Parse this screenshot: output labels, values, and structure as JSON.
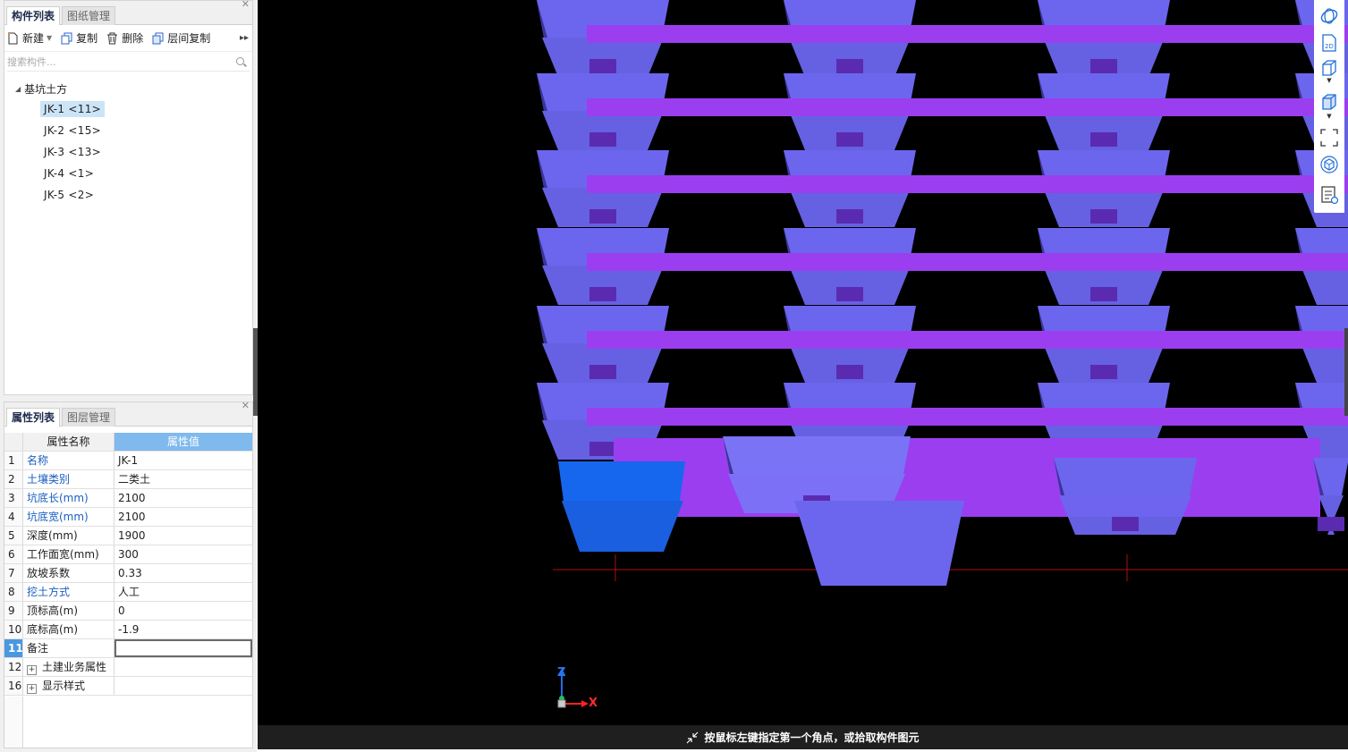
{
  "components_panel": {
    "tabs": [
      "构件列表",
      "图纸管理"
    ],
    "toolbar": {
      "new_label": "新建",
      "copy_label": "复制",
      "delete_label": "删除",
      "floor_copy_label": "层间复制",
      "more_icon": "double-chevron-right-icon"
    },
    "search_placeholder": "搜索构件...",
    "tree": {
      "root_label": "基坑土方",
      "items": [
        "JK-1 <11>",
        "JK-2 <15>",
        "JK-3 <13>",
        "JK-4 <1>",
        "JK-5 <2>"
      ],
      "selected": "JK-1 <11>"
    }
  },
  "properties_panel": {
    "tabs": [
      "属性列表",
      "图层管理"
    ],
    "header": {
      "name_col": "属性名称",
      "value_col": "属性值"
    },
    "rows": [
      {
        "num": "1",
        "name": "名称",
        "value": "JK-1"
      },
      {
        "num": "2",
        "name": "土壤类别",
        "value": "二类土"
      },
      {
        "num": "3",
        "name": "坑底长(mm)",
        "value": "2100"
      },
      {
        "num": "4",
        "name": "坑底宽(mm)",
        "value": "2100"
      },
      {
        "num": "5",
        "name": "深度(mm)",
        "value": "1900"
      },
      {
        "num": "6",
        "name": "工作面宽(mm)",
        "value": "300"
      },
      {
        "num": "7",
        "name": "放坡系数",
        "value": "0.33"
      },
      {
        "num": "8",
        "name": "挖土方式",
        "value": "人工"
      },
      {
        "num": "9",
        "name": "顶标高(m)",
        "value": "0"
      },
      {
        "num": "10",
        "name": "底标高(m)",
        "value": "-1.9"
      },
      {
        "num": "11",
        "name": "备注",
        "value": ""
      },
      {
        "num": "12",
        "name": "土建业务属性",
        "value": ""
      },
      {
        "num": "16",
        "name": "显示样式",
        "value": ""
      }
    ]
  },
  "viewport": {
    "status_text": "按鼠标左键指定第一个角点，或拾取构件图元",
    "axis_labels": {
      "z": "Z",
      "x": "X"
    },
    "nav_icons": [
      "orbit-icon",
      "2d-view-icon",
      "3d-view-icon",
      "3d-solid-view-icon",
      "fit-view-icon",
      "view-cube-icon",
      "layer-settings-icon"
    ]
  },
  "colors": {
    "pit_face": "#6c66ee",
    "pit_light": "#7a73f5",
    "beam": "#9b3ef0",
    "selected_pit": "#1667ee",
    "axis_red": "#ff2222",
    "accent_blue": "#4b97e0"
  }
}
